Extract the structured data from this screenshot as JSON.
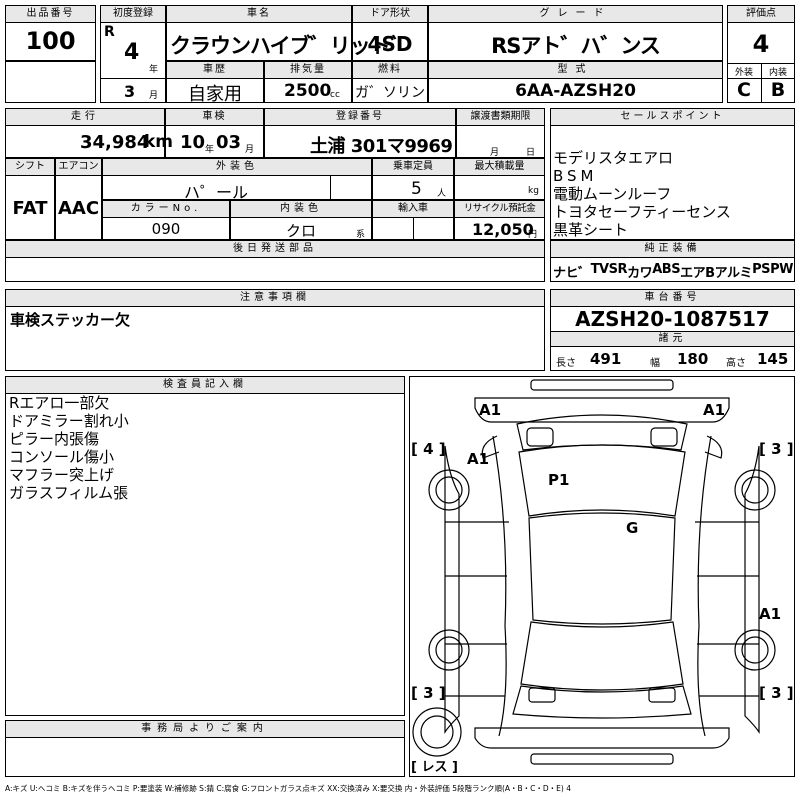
{
  "lot": {
    "label": "出品番号",
    "value": "100"
  },
  "first_reg": {
    "label": "初度登録",
    "era": "R",
    "year": "4",
    "year_unit": "年",
    "month": "3",
    "month_unit": "月"
  },
  "car_name": {
    "label": "車名",
    "value": "クラウンハイブ゛リット゛"
  },
  "door": {
    "label": "ドア形状",
    "value": "4SD"
  },
  "grade": {
    "label": "グレード",
    "value": "RSアト゛ハ゛ンス"
  },
  "score": {
    "label": "評価点",
    "value": "4",
    "ext_label": "外装",
    "int_label": "内装",
    "ext": "C",
    "int": "B"
  },
  "history": {
    "label": "車歴",
    "value": "自家用"
  },
  "displacement": {
    "label": "排気量",
    "value": "2500",
    "unit": "cc"
  },
  "fuel": {
    "label": "燃料",
    "value": "ガ゛ソリン"
  },
  "model_code": {
    "label": "型式",
    "value": "6AA-AZSH20"
  },
  "mileage": {
    "label": "走行",
    "value": "34,984",
    "unit": "km"
  },
  "inspection": {
    "label": "車検",
    "year": "10",
    "year_unit": "年",
    "month": "03",
    "month_unit": "月"
  },
  "plate": {
    "label": "登録番号",
    "value": "土浦 301マ9969"
  },
  "transfer": {
    "label": "譲渡書類期限",
    "month_unit": "月",
    "day_unit": "日"
  },
  "sales": {
    "label": "セールスポイント",
    "items": [
      "モデリスタエアロ",
      "BSM",
      "電動ムーンルーフ",
      "トヨタセーフティーセンス",
      "黒革シート"
    ]
  },
  "shift": {
    "label": "シフト",
    "value": "FAT"
  },
  "ac": {
    "label": "エアコン",
    "value": "AAC"
  },
  "ext_color": {
    "label": "外装色",
    "value": "ハ゜ール"
  },
  "capacity": {
    "label": "乗車定員",
    "value": "5",
    "unit": "人"
  },
  "max_load": {
    "label": "最大積載量",
    "unit": "kg"
  },
  "color_no": {
    "label": "カラーNo.",
    "value": "090"
  },
  "int_color": {
    "label": "内装色",
    "value": "クロ",
    "unit": "系"
  },
  "import": {
    "label": "輸入車"
  },
  "recycle": {
    "label": "リサイクル預託金",
    "value": "12,050",
    "unit": "円"
  },
  "later_parts": {
    "label": "後日発送部品"
  },
  "equipment": {
    "label": "純正装備",
    "items": [
      "ナヒ゛",
      "TV",
      "SR",
      "カワ",
      "ABS",
      "エアB",
      "アルミ",
      "PS",
      "PW"
    ]
  },
  "caution": {
    "label": "注意事項欄",
    "value": "車検ステッカー欠"
  },
  "chassis": {
    "label": "車台番号",
    "value": "AZSH20-1087517"
  },
  "specs": {
    "label": "諸元",
    "length_label": "長さ",
    "length": "491",
    "width_label": "幅",
    "width": "180",
    "height_label": "高さ",
    "height": "145"
  },
  "inspector": {
    "label": "検査員記入欄",
    "items": [
      "Rエアロ一部欠",
      "ドアミラー割れ小",
      "ピラー内張傷",
      "コンソール傷小",
      "マフラー突上げ",
      "ガラスフィルム張"
    ]
  },
  "office": {
    "label": "事務局よりご案内"
  },
  "diagram": {
    "marks": [
      "A1",
      "A1",
      "A1",
      "P1",
      "G",
      "A1"
    ],
    "tires": [
      "[ 4 ]",
      "[ 3 ]",
      "[ 3 ]",
      "[ 3 ]"
    ],
    "spare": "[ レス ]"
  },
  "legend": "A:キズ U:ヘコミ B:キズを伴うヘコミ P:要塗装 W:補修跡 S:錆 C:腐食 G:フロントガラス点キズ XX:交換済み X:要交換 内・外装評価 5段階ランク順(A・B・C・D・E) 4"
}
